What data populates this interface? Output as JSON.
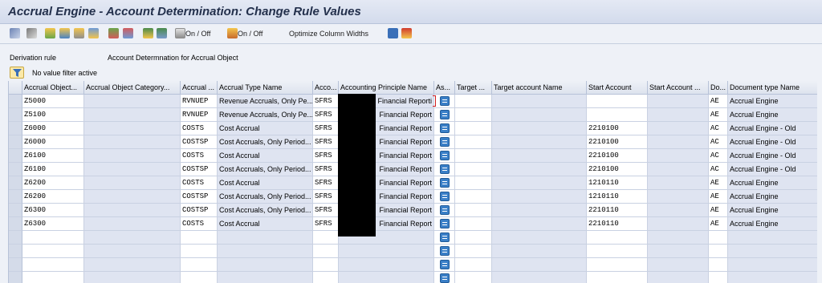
{
  "window": {
    "title": "Accrual Engine - Account Determination: Change Rule Values"
  },
  "toolbar": {
    "icons": [
      "glasses-icon",
      "other-object-icon",
      "add-row-icon",
      "copy-row-icon",
      "delete-row-icon",
      "import-icon",
      "export-icon",
      "layout-icon",
      "sort-ascending-icon",
      "filter-icon"
    ],
    "toggle1_label": "On / Off",
    "toggle2_label": "On / Off",
    "optimize_label": "Optimize Column Widths",
    "info_icon": "info-icon",
    "transport_icon": "transport-icon"
  },
  "info": {
    "derivation_rule_label": "Derivation rule",
    "derivation_rule_value": "Account Determnation for Accrual Object",
    "filter_text": "No value filter active"
  },
  "table": {
    "headers": [
      "Accrual Object...",
      "Accrual Object Category...",
      "Accrual ...",
      "Accrual Type Name",
      "Acco...",
      "Accounting Principle Name",
      "As...",
      "Target ...",
      "Target account Name",
      "Start Account",
      "Start Account ...",
      "Do...",
      "Document type Name"
    ],
    "rows": [
      [
        "Z5000",
        "",
        "RVNUEP",
        "Revenue Accruals, Only Pe...",
        "SFRS",
        "Financial Reporti",
        "",
        "",
        "",
        "",
        "",
        "AE",
        "Accrual Engine"
      ],
      [
        "Z5100",
        "",
        "RVNUEP",
        "Revenue Accruals, Only Pe...",
        "SFRS",
        "Financial Report",
        "",
        "",
        "",
        "",
        "",
        "AE",
        "Accrual Engine"
      ],
      [
        "Z6000",
        "",
        "COSTS",
        "Cost Accrual",
        "SFRS",
        "Financial Report",
        "",
        "",
        "",
        "2210100",
        "",
        "AC",
        "Accrual Engine - Old"
      ],
      [
        "Z6000",
        "",
        "COSTSP",
        "Cost Accruals, Only Period...",
        "SFRS",
        "Financial Report",
        "",
        "",
        "",
        "2210100",
        "",
        "AC",
        "Accrual Engine - Old"
      ],
      [
        "Z6100",
        "",
        "COSTS",
        "Cost Accrual",
        "SFRS",
        "Financial Report",
        "",
        "",
        "",
        "2210100",
        "",
        "AC",
        "Accrual Engine - Old"
      ],
      [
        "Z6100",
        "",
        "COSTSP",
        "Cost Accruals, Only Period...",
        "SFRS",
        "Financial Report",
        "",
        "",
        "",
        "2210100",
        "",
        "AC",
        "Accrual Engine - Old"
      ],
      [
        "Z6200",
        "",
        "COSTS",
        "Cost Accrual",
        "SFRS",
        "Financial Report",
        "",
        "",
        "",
        "1210110",
        "",
        "AE",
        "Accrual Engine"
      ],
      [
        "Z6200",
        "",
        "COSTSP",
        "Cost Accruals, Only Period...",
        "SFRS",
        "Financial Report",
        "",
        "",
        "",
        "1210110",
        "",
        "AE",
        "Accrual Engine"
      ],
      [
        "Z6300",
        "",
        "COSTSP",
        "Cost Accruals, Only Period...",
        "SFRS",
        "Financial Report",
        "",
        "",
        "",
        "2210110",
        "",
        "AE",
        "Accrual Engine"
      ],
      [
        "Z6300",
        "",
        "COSTS",
        "Cost Accrual",
        "SFRS",
        "Financial Report",
        "",
        "",
        "",
        "2210110",
        "",
        "AE",
        "Accrual Engine"
      ]
    ],
    "empty_rows": 4
  },
  "colors": {
    "title_text": "#23304c",
    "readonly_cell": "#dfe4f1",
    "header": "#dde3ee",
    "f4_button": "#3a7fc7",
    "redaction": "#000000"
  }
}
